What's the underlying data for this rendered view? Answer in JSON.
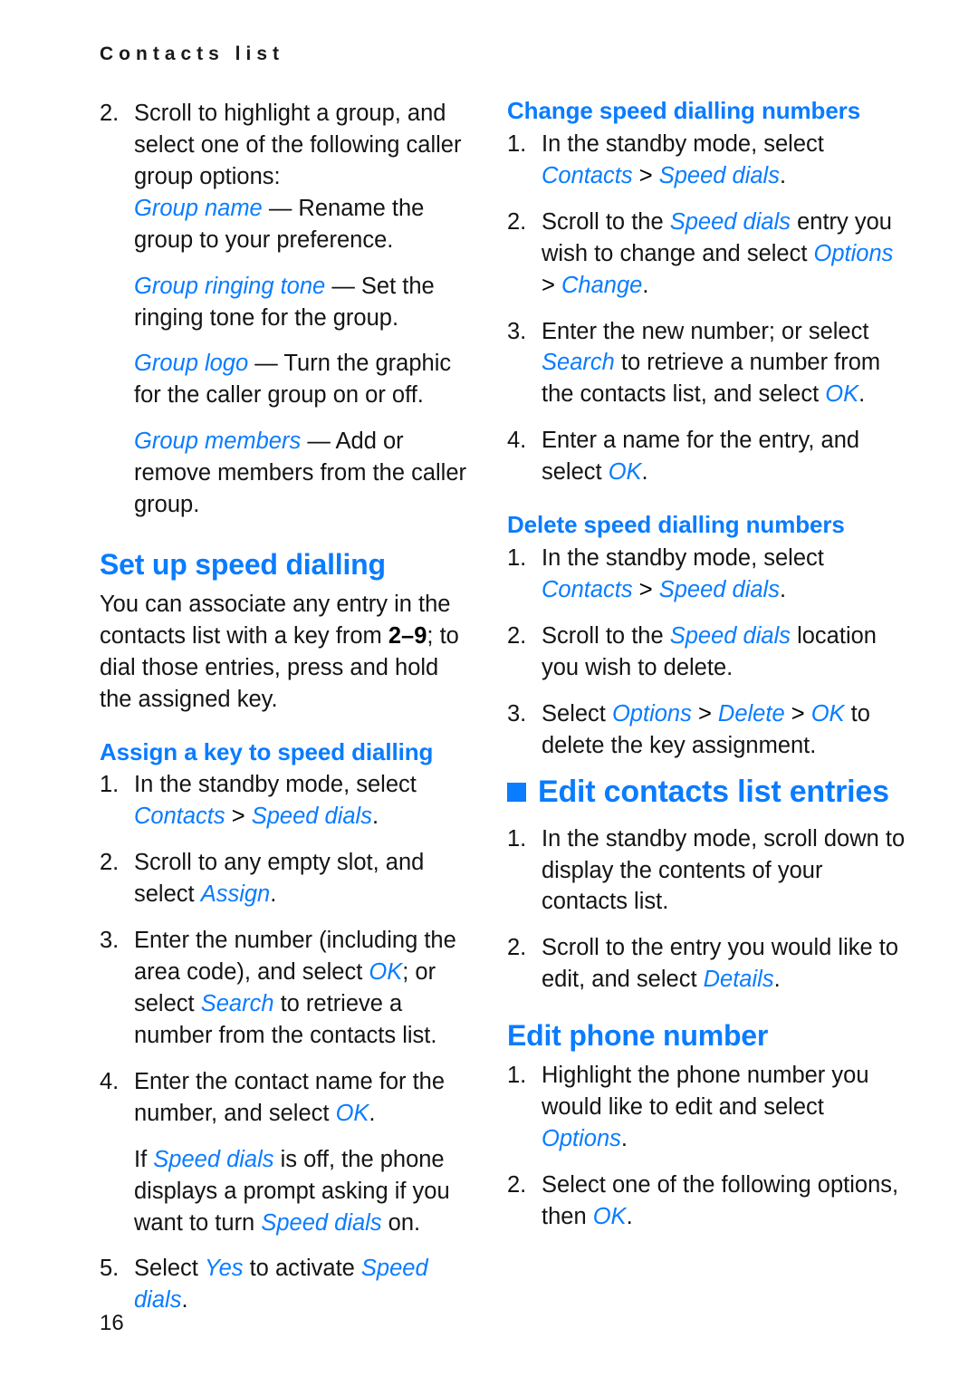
{
  "document": {
    "running_header": "Contacts list",
    "page_number": "16"
  },
  "colors": {
    "accent_blue": "#0a7cff",
    "body_text": "#141414"
  },
  "left_column": {
    "step2": {
      "num": "2.",
      "text": "Scroll to highlight a group, and select one of the following caller group options:"
    },
    "group_options": [
      {
        "term": "Group name",
        "dash": " — ",
        "desc": "Rename the group to your preference."
      },
      {
        "term": "Group ringing tone",
        "dash": " — ",
        "desc": "Set the ringing tone for the group."
      },
      {
        "term": "Group logo",
        "dash": " — ",
        "desc": "Turn the graphic for the caller group on or off."
      },
      {
        "term": "Group members",
        "dash": " — ",
        "desc": "Add or remove members from the caller group."
      }
    ],
    "set_up_speed_dialling": {
      "heading": "Set up speed dialling",
      "intro_a": "You can associate any entry in the contacts list with a key from ",
      "intro_key": "2–9",
      "intro_b": "; to dial those entries, press and hold the assigned key."
    },
    "assign_key": {
      "heading": "Assign a key to speed dialling",
      "steps": [
        {
          "num": "1.",
          "parts": [
            {
              "type": "text",
              "value": "In the standby mode, select "
            },
            {
              "type": "term",
              "value": "Contacts"
            },
            {
              "type": "sep",
              "value": " > "
            },
            {
              "type": "term",
              "value": "Speed dials"
            },
            {
              "type": "text",
              "value": "."
            }
          ]
        },
        {
          "num": "2.",
          "parts": [
            {
              "type": "text",
              "value": "Scroll to any empty slot, and select "
            },
            {
              "type": "term",
              "value": "Assign"
            },
            {
              "type": "text",
              "value": "."
            }
          ]
        },
        {
          "num": "3.",
          "parts": [
            {
              "type": "text",
              "value": "Enter the number (including the area code), and select "
            },
            {
              "type": "term",
              "value": "OK"
            },
            {
              "type": "text",
              "value": "; or select "
            },
            {
              "type": "term",
              "value": "Search"
            },
            {
              "type": "text",
              "value": " to retrieve a number from the contacts list."
            }
          ]
        },
        {
          "num": "4.",
          "parts": [
            {
              "type": "text",
              "value": "Enter the contact name for the number, and select "
            },
            {
              "type": "term",
              "value": "OK"
            },
            {
              "type": "text",
              "value": "."
            }
          ]
        },
        {
          "num": "5.",
          "parts": [
            {
              "type": "text",
              "value": "Select "
            },
            {
              "type": "term",
              "value": "Yes"
            },
            {
              "type": "text",
              "value": " to activate "
            },
            {
              "type": "term",
              "value": "Speed dials"
            },
            {
              "type": "text",
              "value": "."
            }
          ]
        }
      ],
      "note_after_step4": [
        {
          "type": "text",
          "value": "If "
        },
        {
          "type": "term",
          "value": "Speed dials"
        },
        {
          "type": "text",
          "value": " is off, the phone displays a prompt asking if you want to turn "
        },
        {
          "type": "term",
          "value": "Speed dials"
        },
        {
          "type": "text",
          "value": " on."
        }
      ]
    }
  },
  "right_column": {
    "change_speed_dialling": {
      "heading": "Change speed dialling numbers",
      "steps": [
        {
          "num": "1.",
          "parts": [
            {
              "type": "text",
              "value": "In the standby mode, select "
            },
            {
              "type": "term",
              "value": "Contacts"
            },
            {
              "type": "sep",
              "value": " > "
            },
            {
              "type": "term",
              "value": "Speed dials"
            },
            {
              "type": "text",
              "value": "."
            }
          ]
        },
        {
          "num": "2.",
          "parts": [
            {
              "type": "text",
              "value": "Scroll to the "
            },
            {
              "type": "term",
              "value": "Speed dials"
            },
            {
              "type": "text",
              "value": " entry you wish to change and select "
            },
            {
              "type": "term",
              "value": "Options"
            },
            {
              "type": "sep",
              "value": " > "
            },
            {
              "type": "term",
              "value": "Change"
            },
            {
              "type": "text",
              "value": "."
            }
          ]
        },
        {
          "num": "3.",
          "parts": [
            {
              "type": "text",
              "value": "Enter the new number; or select "
            },
            {
              "type": "term",
              "value": "Search"
            },
            {
              "type": "text",
              "value": " to retrieve a number from the contacts list, and select "
            },
            {
              "type": "term",
              "value": "OK"
            },
            {
              "type": "text",
              "value": "."
            }
          ]
        },
        {
          "num": "4.",
          "parts": [
            {
              "type": "text",
              "value": "Enter a name for the entry, and select "
            },
            {
              "type": "term",
              "value": "OK"
            },
            {
              "type": "text",
              "value": "."
            }
          ]
        }
      ]
    },
    "delete_speed_dialling": {
      "heading": "Delete speed dialling numbers",
      "steps": [
        {
          "num": "1.",
          "parts": [
            {
              "type": "text",
              "value": "In the standby mode, select "
            },
            {
              "type": "term",
              "value": "Contacts"
            },
            {
              "type": "sep",
              "value": " > "
            },
            {
              "type": "term",
              "value": "Speed dials"
            },
            {
              "type": "text",
              "value": "."
            }
          ]
        },
        {
          "num": "2.",
          "parts": [
            {
              "type": "text",
              "value": "Scroll to the "
            },
            {
              "type": "term",
              "value": "Speed dials"
            },
            {
              "type": "text",
              "value": " location you wish to delete."
            }
          ]
        },
        {
          "num": "3.",
          "parts": [
            {
              "type": "text",
              "value": "Select "
            },
            {
              "type": "term",
              "value": "Options"
            },
            {
              "type": "sep",
              "value": " > "
            },
            {
              "type": "term",
              "value": "Delete"
            },
            {
              "type": "sep",
              "value": " > "
            },
            {
              "type": "term",
              "value": "OK"
            },
            {
              "type": "text",
              "value": " to delete the key assignment."
            }
          ]
        }
      ]
    },
    "edit_contacts_list_entries": {
      "heading": "Edit contacts list entries",
      "bullet_icon": "square-bullet-icon",
      "steps": [
        {
          "num": "1.",
          "parts": [
            {
              "type": "text",
              "value": "In the standby mode, scroll down to display the contents of your contacts list."
            }
          ]
        },
        {
          "num": "2.",
          "parts": [
            {
              "type": "text",
              "value": "Scroll to the entry you would like to edit, and select "
            },
            {
              "type": "term",
              "value": "Details"
            },
            {
              "type": "text",
              "value": "."
            }
          ]
        }
      ]
    },
    "edit_phone_number": {
      "heading": "Edit phone number",
      "steps": [
        {
          "num": "1.",
          "parts": [
            {
              "type": "text",
              "value": "Highlight the phone number you would like to edit and select "
            },
            {
              "type": "term",
              "value": "Options"
            },
            {
              "type": "text",
              "value": "."
            }
          ]
        },
        {
          "num": "2.",
          "parts": [
            {
              "type": "text",
              "value": "Select one of the following options, then "
            },
            {
              "type": "term",
              "value": "OK"
            },
            {
              "type": "text",
              "value": "."
            }
          ]
        }
      ]
    }
  }
}
